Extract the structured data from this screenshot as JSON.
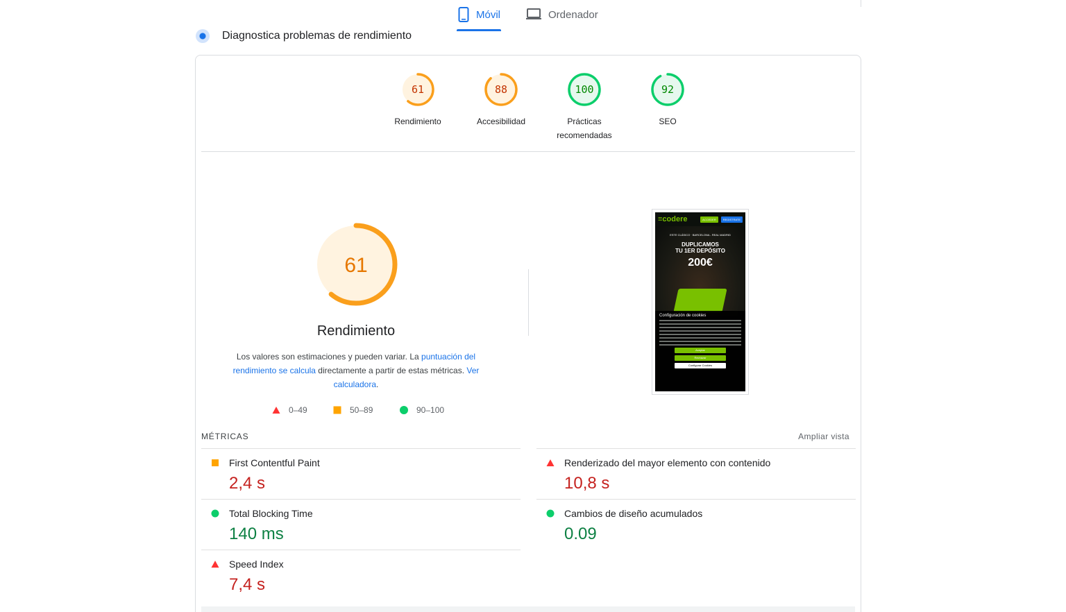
{
  "tabs": [
    {
      "label": "Móvil",
      "icon": "smartphone-icon",
      "active": true
    },
    {
      "label": "Ordenador",
      "icon": "laptop-icon",
      "active": false
    }
  ],
  "header": {
    "title": "Diagnostica problemas de rendimiento"
  },
  "categories": [
    {
      "score": "61",
      "label": "Rendimiento",
      "value": 61,
      "color": "#fa9f1c"
    },
    {
      "score": "88",
      "label": "Accesibilidad",
      "value": 88,
      "color": "#fa9f1c"
    },
    {
      "score": "100",
      "label_line1": "Prácticas",
      "label_line2": "recomendadas",
      "value": 100,
      "color": "#0cce6b"
    },
    {
      "score": "92",
      "label": "SEO",
      "value": 92,
      "color": "#0cce6b"
    }
  ],
  "performance": {
    "score": "61",
    "value": 61,
    "title": "Rendimiento",
    "desc_part1": "Los valores son estimaciones y pueden variar. La ",
    "desc_link1": "puntuación del rendimiento se calcula",
    "desc_part2": " directamente a partir de estas métricas. ",
    "desc_link2": "Ver calculadora",
    "desc_part3": "."
  },
  "legend": [
    {
      "range": "0–49",
      "shape": "triangle",
      "color": "#ff3333"
    },
    {
      "range": "50–89",
      "shape": "square",
      "color": "#ffa400"
    },
    {
      "range": "90–100",
      "shape": "circle",
      "color": "#0cce6b"
    }
  ],
  "preview": {
    "logo": "≡codere",
    "btn_login": "ACCEDER",
    "btn_register": "REGISTRATE",
    "hero_small": "ESTE CLÁSICO · BARCELONA - REAL MADRID",
    "hero_line1": "DUPLICAMOS",
    "hero_line2": "TU 1ER DEPÓSITO",
    "hero_amount": "200€",
    "cookie_title": "Configuración de cookies",
    "cookie_accept": "Aceptar",
    "cookie_reject": "Rechazar",
    "cookie_config": "Configurar Cookies"
  },
  "metrics": {
    "title": "MÉTRICAS",
    "expand": "Ampliar vista",
    "items": [
      {
        "name": "First Contentful Paint",
        "value": "2,4 s",
        "status": "average"
      },
      {
        "name": "Renderizado del mayor elemento con contenido",
        "value": "10,8 s",
        "status": "fail"
      },
      {
        "name": "Total Blocking Time",
        "value": "140 ms",
        "status": "pass"
      },
      {
        "name": "Cambios de diseño acumulados",
        "value": "0.09",
        "status": "pass"
      },
      {
        "name": "Speed Index",
        "value": "7,4 s",
        "status": "fail"
      }
    ]
  }
}
